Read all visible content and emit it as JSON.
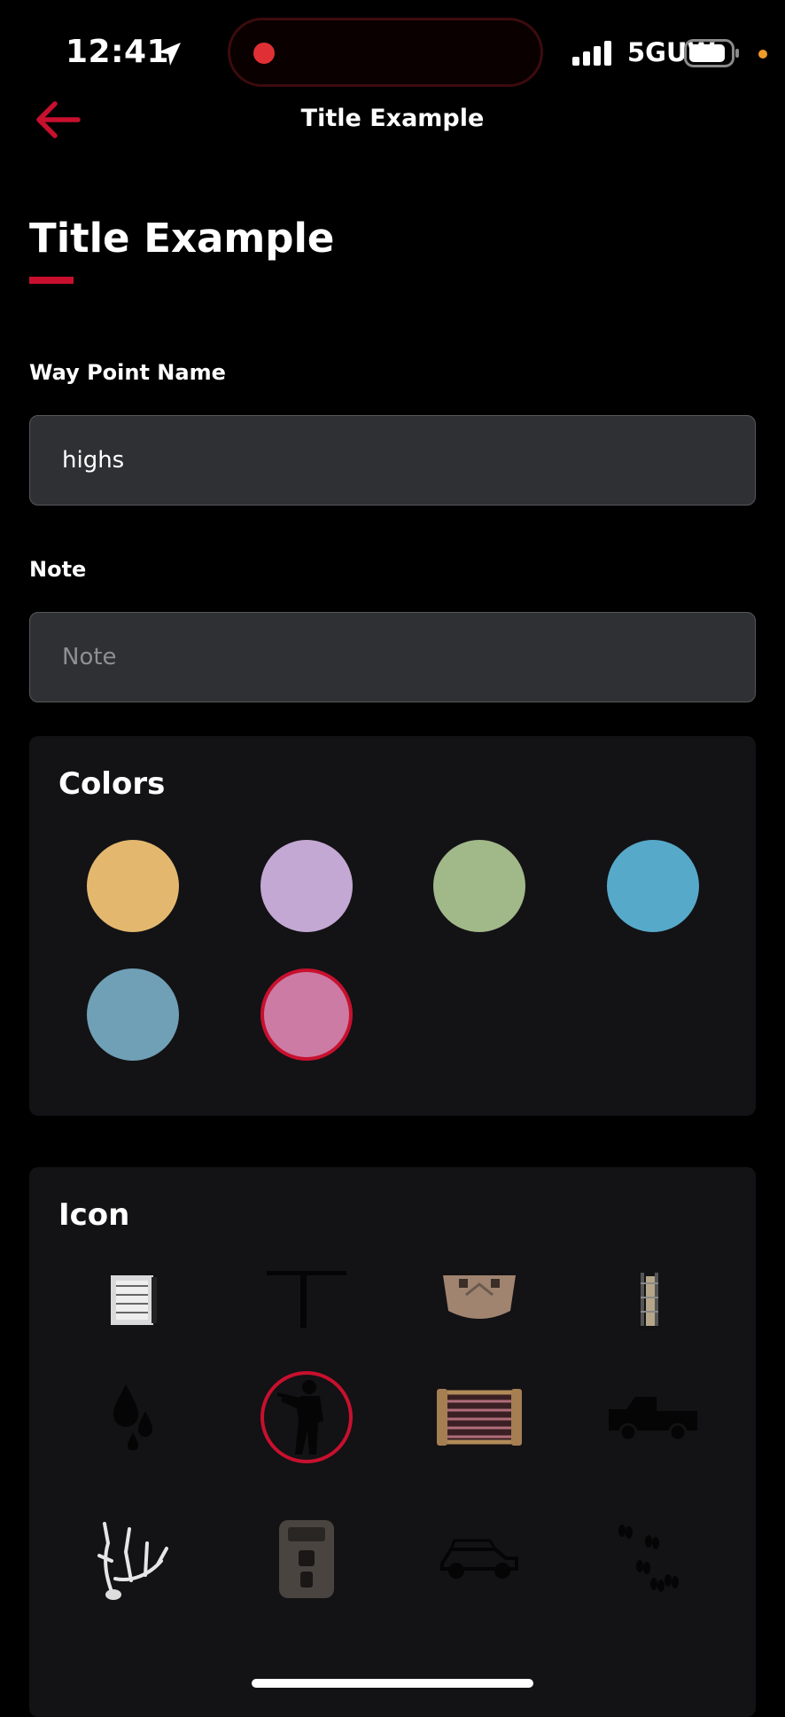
{
  "status_bar": {
    "time": "12:41",
    "network": "5GUW"
  },
  "nav": {
    "back_label": "Back",
    "title": "Title Example"
  },
  "page": {
    "title": "Title Example"
  },
  "form": {
    "waypoint_label": "Way Point Name",
    "waypoint_value": "highs",
    "note_label": "Note",
    "note_placeholder": "Note",
    "note_value": ""
  },
  "colors_section": {
    "title": "Colors",
    "swatches": [
      {
        "name": "yellow",
        "hex": "#e3b86e",
        "selected": false
      },
      {
        "name": "lavender",
        "hex": "#c3a8d3",
        "selected": false
      },
      {
        "name": "green",
        "hex": "#a1b889",
        "selected": false
      },
      {
        "name": "blue",
        "hex": "#56a9c9",
        "selected": false
      },
      {
        "name": "steel-blue",
        "hex": "#6fa0b6",
        "selected": false
      },
      {
        "name": "pink",
        "hex": "#cc7ba4",
        "selected": true
      }
    ],
    "selection_color": "#c8102e"
  },
  "icon_section": {
    "title": "Icon",
    "icons": [
      {
        "name": "blind-stand-icon",
        "selected": false
      },
      {
        "name": "t-post-icon",
        "selected": false
      },
      {
        "name": "feeder-icon",
        "selected": false
      },
      {
        "name": "ladder-stand-icon",
        "selected": false
      },
      {
        "name": "blood-drops-icon",
        "selected": false
      },
      {
        "name": "hunter-icon",
        "selected": true
      },
      {
        "name": "trap-icon",
        "selected": false
      },
      {
        "name": "pickup-truck-icon",
        "selected": false
      },
      {
        "name": "antler-icon",
        "selected": false
      },
      {
        "name": "trail-camera-icon",
        "selected": false
      },
      {
        "name": "utv-icon",
        "selected": false
      },
      {
        "name": "tracks-icon",
        "selected": false
      }
    ]
  },
  "theme": {
    "accent": "#c8102e",
    "background": "#000000",
    "card": "#131215",
    "input": "#2f3033"
  }
}
